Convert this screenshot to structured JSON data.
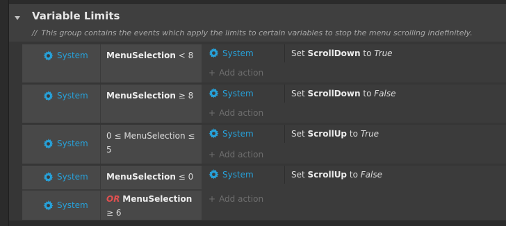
{
  "group": {
    "title": "Variable Limits",
    "description_prefix": "//",
    "description": "This group contains the events which apply the limits to certain variables to stop the menu scrolling indefinitely."
  },
  "system_label": "System",
  "add_action_label": "Add action",
  "events": [
    {
      "conditions": [
        {
          "object": "System",
          "variable": "MenuSelection",
          "op": "< 8"
        }
      ],
      "action": {
        "object": "System",
        "verb": "Set",
        "variable": "ScrollDown",
        "to": "to",
        "value": "True"
      }
    },
    {
      "conditions": [
        {
          "object": "System",
          "variable": "MenuSelection",
          "op": "≥ 8"
        }
      ],
      "action": {
        "object": "System",
        "verb": "Set",
        "variable": "ScrollDown",
        "to": "to",
        "value": "False"
      }
    },
    {
      "conditions": [
        {
          "object": "System",
          "text": "0 ≤ MenuSelection ≤ 5"
        }
      ],
      "action": {
        "object": "System",
        "verb": "Set",
        "variable": "ScrollUp",
        "to": "to",
        "value": "True"
      }
    },
    {
      "conditions": [
        {
          "object": "System",
          "variable": "MenuSelection",
          "op": "≤ 0"
        },
        {
          "object": "System",
          "or": "OR",
          "variable": "MenuSelection",
          "op": "≥ 6"
        }
      ],
      "action": {
        "object": "System",
        "verb": "Set",
        "variable": "ScrollUp",
        "to": "to",
        "value": "False"
      }
    }
  ]
}
